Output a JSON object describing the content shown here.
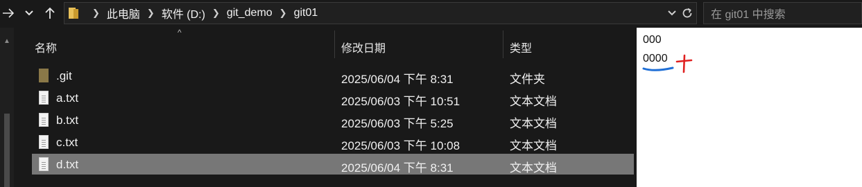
{
  "nav": {
    "forward_icon": "arrow-right",
    "recent_icon": "chevron-down",
    "up_icon": "arrow-up"
  },
  "address": {
    "crumbs": [
      "此电脑",
      "软件 (D:)",
      "git_demo",
      "git01"
    ]
  },
  "search": {
    "placeholder": "在 git01 中搜索"
  },
  "columns": {
    "name": "名称",
    "date": "修改日期",
    "type": "类型"
  },
  "files": [
    {
      "name": ".git",
      "date": "2025/06/04 下午 8:31",
      "type": "文件夹",
      "icon": "folder-icon"
    },
    {
      "name": "a.txt",
      "date": "2025/06/03 下午 10:51",
      "type": "文本文档",
      "icon": "text-file-icon"
    },
    {
      "name": "b.txt",
      "date": "2025/06/03 下午 5:25",
      "type": "文本文档",
      "icon": "text-file-icon"
    },
    {
      "name": "c.txt",
      "date": "2025/06/03 下午 10:08",
      "type": "文本文档",
      "icon": "text-file-icon"
    },
    {
      "name": "d.txt",
      "date": "2025/06/04 下午 8:31",
      "type": "文本文档",
      "icon": "text-file-icon",
      "selected": true
    }
  ],
  "preview": {
    "lines": [
      "000",
      "0000"
    ],
    "annotation_colors": {
      "underline": "#1f6fd6",
      "plus": "#e02020"
    }
  }
}
